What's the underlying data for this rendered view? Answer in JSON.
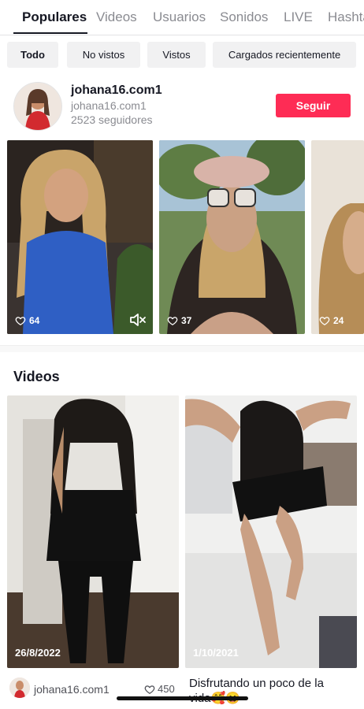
{
  "tabs": [
    {
      "label": "Populares",
      "active": true
    },
    {
      "label": "Videos"
    },
    {
      "label": "Usuarios"
    },
    {
      "label": "Sonidos"
    },
    {
      "label": "LIVE"
    },
    {
      "label": "Hashtags"
    }
  ],
  "filters": [
    {
      "label": "Todo",
      "active": true
    },
    {
      "label": "No vistos"
    },
    {
      "label": "Vistos"
    },
    {
      "label": "Cargados recientemente"
    }
  ],
  "user": {
    "name": "johana16.com1",
    "id": "johana16.com1",
    "followers": "2523 seguidores",
    "follow_label": "Seguir"
  },
  "user_videos": [
    {
      "likes": "64",
      "muted": true
    },
    {
      "likes": "37"
    },
    {
      "likes": "24"
    }
  ],
  "videos_section": {
    "title": "Videos",
    "items": [
      {
        "date": "26/8/2022",
        "author": "johana16.com1",
        "likes": "450"
      },
      {
        "date": "1/10/2021",
        "caption": "Disfrutando un poco de la vida🥰😀"
      }
    ]
  },
  "icons": [
    "heart-outline-icon",
    "speaker-muted-icon"
  ],
  "colors": {
    "accent": "#fe2c55",
    "text": "#161823",
    "muted": "#8a8b91",
    "chip_bg": "#f1f1f2"
  }
}
